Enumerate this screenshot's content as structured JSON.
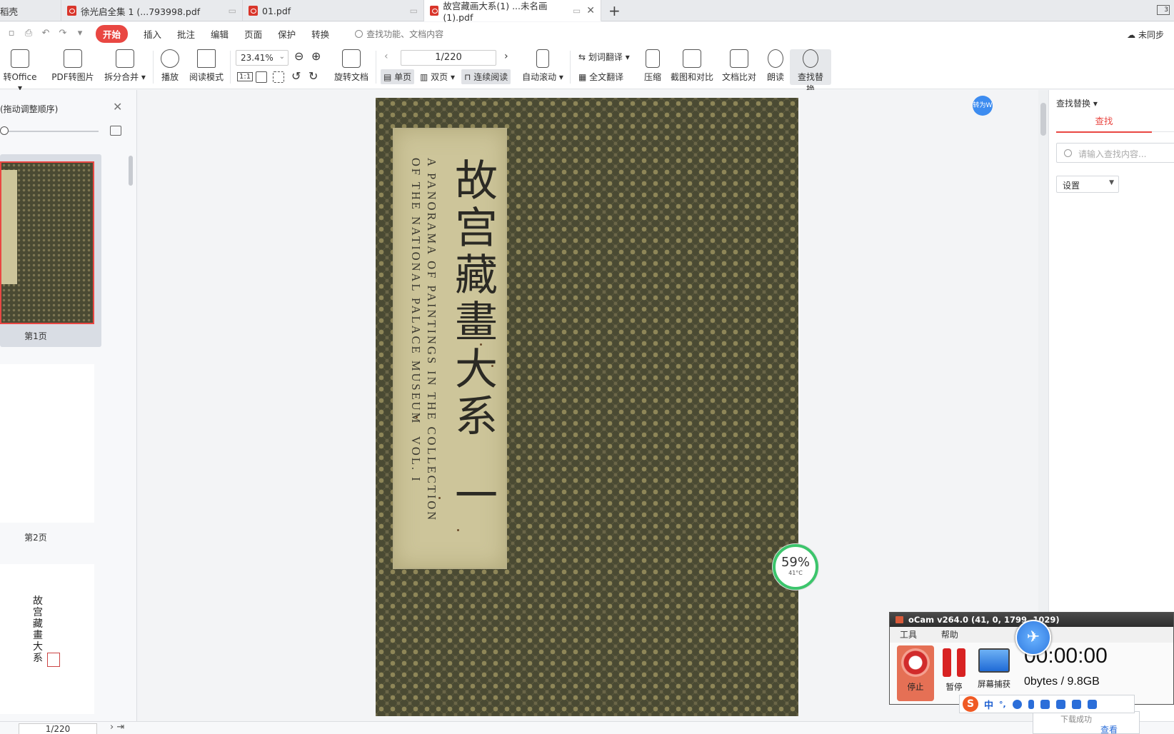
{
  "tabs": [
    {
      "label": "稻壳",
      "active": false
    },
    {
      "label": "徐光启全集  1   (...793998.pdf",
      "active": false
    },
    {
      "label": "01.pdf",
      "active": false
    },
    {
      "label": "故宫藏画大系(1) ...未名画(1).pdf",
      "active": true
    }
  ],
  "new_tab": "+",
  "menu": {
    "items": [
      "开始",
      "插入",
      "批注",
      "编辑",
      "页面",
      "保护",
      "转换"
    ],
    "search_placeholder": "查找功能、文档内容",
    "sync": "未同步"
  },
  "ribbon": {
    "to_office": "转Office",
    "pdf_to_image": "PDF转图片",
    "split_merge": "拆分合并",
    "play": "播放",
    "read_mode": "阅读模式",
    "zoom": "23.41%",
    "rotate": "旋转文档",
    "page_indicator": "1/220",
    "single_page": "单页",
    "double_page": "双页",
    "continuous": "连续阅读",
    "auto_scroll": "自动滚动",
    "word_translate": "划词翻译",
    "full_translate": "全文翻译",
    "compress": "压缩",
    "screenshot_compare": "截图和对比",
    "doc_compare": "文档比对",
    "read_aloud": "朗读",
    "find_replace": "查找替换"
  },
  "left_panel": {
    "title": "(拖动调整顺序)",
    "thumbs": [
      {
        "label": "第1页",
        "selected": true
      },
      {
        "label": "第2页",
        "selected": false
      }
    ]
  },
  "page_content": {
    "title_cn": "故宫藏畫大系",
    "volume_cn": "一",
    "english_1": "A PANORAMA OF PAINTINGS IN THE COLLECTION",
    "english_2": "OF THE NATIONAL PALACE MUSEUM",
    "english_3": "VOL. I"
  },
  "perf_widget": {
    "percent": "59%",
    "temp": "41°C"
  },
  "convert_badge": "转为W",
  "right_panel": {
    "title": "查找替换",
    "tab": "查找",
    "search_placeholder": "请输入查找内容...",
    "settings": "设置"
  },
  "status_bar": {
    "page": "1/220"
  },
  "ocam": {
    "title": "oCam v264.0 (41, 0, 1799, 1029)",
    "menu": [
      "工具",
      "帮助"
    ],
    "stop": "停止",
    "pause": "暂停",
    "screen_capture": "屏幕捕获",
    "timer": "00:00:00",
    "bytes": "0bytes / 9.8GB"
  },
  "ime": {
    "mode": "中",
    "punct": "°,"
  },
  "toast": {
    "text": "下载成功",
    "view": "查看"
  },
  "colors": {
    "accent": "#e94742",
    "perf_ring": "#3cc56c",
    "page_bg": "#4a4a33",
    "label_bg": "#cdc59a"
  }
}
